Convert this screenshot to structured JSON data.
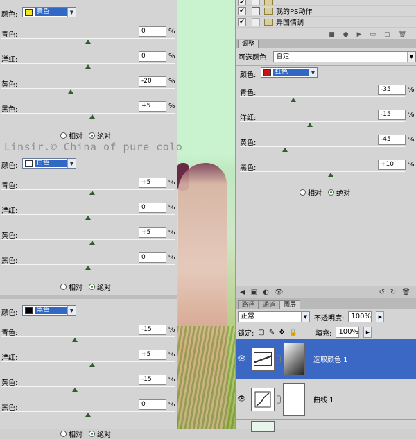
{
  "left_panel": {
    "sections": [
      {
        "color_label": "颜色:",
        "color_name": "黄色",
        "swatch": "#f2ea12",
        "sliders": [
          {
            "label": "青色:",
            "value": "0",
            "unit": "%",
            "pos": 0.5
          },
          {
            "label": "洋红:",
            "value": "0",
            "unit": "%",
            "pos": 0.5
          },
          {
            "label": "黄色:",
            "value": "-20",
            "unit": "%",
            "pos": 0.4
          },
          {
            "label": "黑色:",
            "value": "+5",
            "unit": "%",
            "pos": 0.525
          }
        ],
        "relative_label": "相对",
        "absolute_label": "绝对",
        "selected": "absolute"
      },
      {
        "color_label": "颜色:",
        "color_name": "白色",
        "swatch": "#ffffff",
        "sliders": [
          {
            "label": "青色:",
            "value": "+5",
            "unit": "%",
            "pos": 0.525
          },
          {
            "label": "洋红:",
            "value": "0",
            "unit": "%",
            "pos": 0.5
          },
          {
            "label": "黄色:",
            "value": "+5",
            "unit": "%",
            "pos": 0.525
          },
          {
            "label": "黑色:",
            "value": "0",
            "unit": "%",
            "pos": 0.5
          }
        ],
        "relative_label": "相对",
        "absolute_label": "绝对",
        "selected": "absolute"
      },
      {
        "color_label": "颜色:",
        "color_name": "黑色",
        "swatch": "#000000",
        "sliders": [
          {
            "label": "青色:",
            "value": "-15",
            "unit": "%",
            "pos": 0.425
          },
          {
            "label": "洋红:",
            "value": "+5",
            "unit": "%",
            "pos": 0.525
          },
          {
            "label": "黄色:",
            "value": "-15",
            "unit": "%",
            "pos": 0.425
          },
          {
            "label": "黑色:",
            "value": "0",
            "unit": "%",
            "pos": 0.5
          }
        ],
        "relative_label": "相对",
        "absolute_label": "绝对",
        "selected": "absolute"
      }
    ],
    "watermark": "Linsir.© China of pure colo"
  },
  "actions_panel": {
    "items": [
      {
        "label": "...",
        "checked": true
      },
      {
        "label": "我的PS动作",
        "checked": true
      },
      {
        "label": "异国情调",
        "checked": true
      }
    ]
  },
  "adjust_panel": {
    "tab": "调整",
    "title": "可选颜色",
    "preset": "自定",
    "color_label": "颜色:",
    "color_name": "红色",
    "swatch": "#cc1111",
    "sliders": [
      {
        "label": "青色:",
        "value": "-35",
        "unit": "%",
        "pos": 0.325
      },
      {
        "label": "洋红:",
        "value": "-15",
        "unit": "%",
        "pos": 0.425
      },
      {
        "label": "黄色:",
        "value": "-45",
        "unit": "%",
        "pos": 0.275
      },
      {
        "label": "黑色:",
        "value": "+10",
        "unit": "%",
        "pos": 0.55
      }
    ],
    "relative_label": "相对",
    "absolute_label": "绝对",
    "selected": "absolute"
  },
  "layers_panel": {
    "tabs": [
      "路径",
      "通道",
      "图层"
    ],
    "blend_mode": "正常",
    "opacity_label": "不透明度:",
    "opacity_value": "100%",
    "lock_label": "锁定:",
    "fill_label": "填充:",
    "fill_value": "100%",
    "layers": [
      {
        "name": "选取颜色 1",
        "selected": true
      },
      {
        "name": "曲线 1",
        "selected": false
      }
    ]
  }
}
